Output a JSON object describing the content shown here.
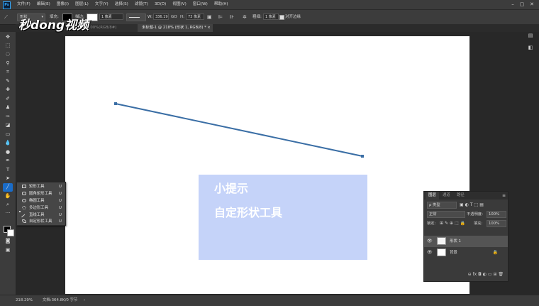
{
  "menu": {
    "logo": "Ps",
    "items": [
      "文件(F)",
      "编辑(E)",
      "图像(I)",
      "图层(L)",
      "文字(Y)",
      "选择(S)",
      "滤镜(T)",
      "3D(D)",
      "视图(V)",
      "窗口(W)",
      "帮助(H)"
    ]
  },
  "options": {
    "mode": "形状",
    "fill_label": "填充:",
    "stroke_label": "描边:",
    "stroke_width": "1 像素",
    "w_label": "W:",
    "w_value": "336.19",
    "link_icon": "GO",
    "h_label": "H:",
    "h_value": "73 像素",
    "weight_label": "粗细:",
    "weight_value": "1 像素",
    "align_edges": "对齐边缘",
    "fill_color": "#000000",
    "stroke_color": "#ffffff"
  },
  "watermark": "秒dong视频",
  "tabs": [
    {
      "label": "100%(RGB/8#)"
    },
    {
      "label": "未标题-1 @ 218% (形状 1, RGB/8) *",
      "close": "×"
    }
  ],
  "flyout": {
    "items": [
      {
        "label": "矩形工具",
        "key": "U"
      },
      {
        "label": "圆角矩形工具",
        "key": "U"
      },
      {
        "label": "椭圆工具",
        "key": "U"
      },
      {
        "label": "多边形工具",
        "key": "U"
      },
      {
        "label": "直线工具",
        "key": "U"
      },
      {
        "label": "自定形状工具",
        "key": "U"
      }
    ]
  },
  "tip": {
    "line1": "小提示",
    "line2": "自定形状工具"
  },
  "line": {
    "color": "#3a6ea5"
  },
  "layers_panel": {
    "tabs": [
      "图层",
      "通道",
      "路径"
    ],
    "kind": "ρ 类型",
    "blend": "正常",
    "opacity_label": "不透明度:",
    "opacity": "100%",
    "lock_label": "锁定:",
    "fill_label": "填充:",
    "fill": "100%",
    "layers": [
      {
        "name": "形状 1",
        "selected": true
      },
      {
        "name": "背景",
        "selected": false
      }
    ],
    "bottom_icons": "⊖  fx  ◘  ◐  ▭  ⊞  🗑"
  },
  "status": {
    "zoom": "218.29%",
    "doc": "文档:364.8K/0 字节"
  }
}
